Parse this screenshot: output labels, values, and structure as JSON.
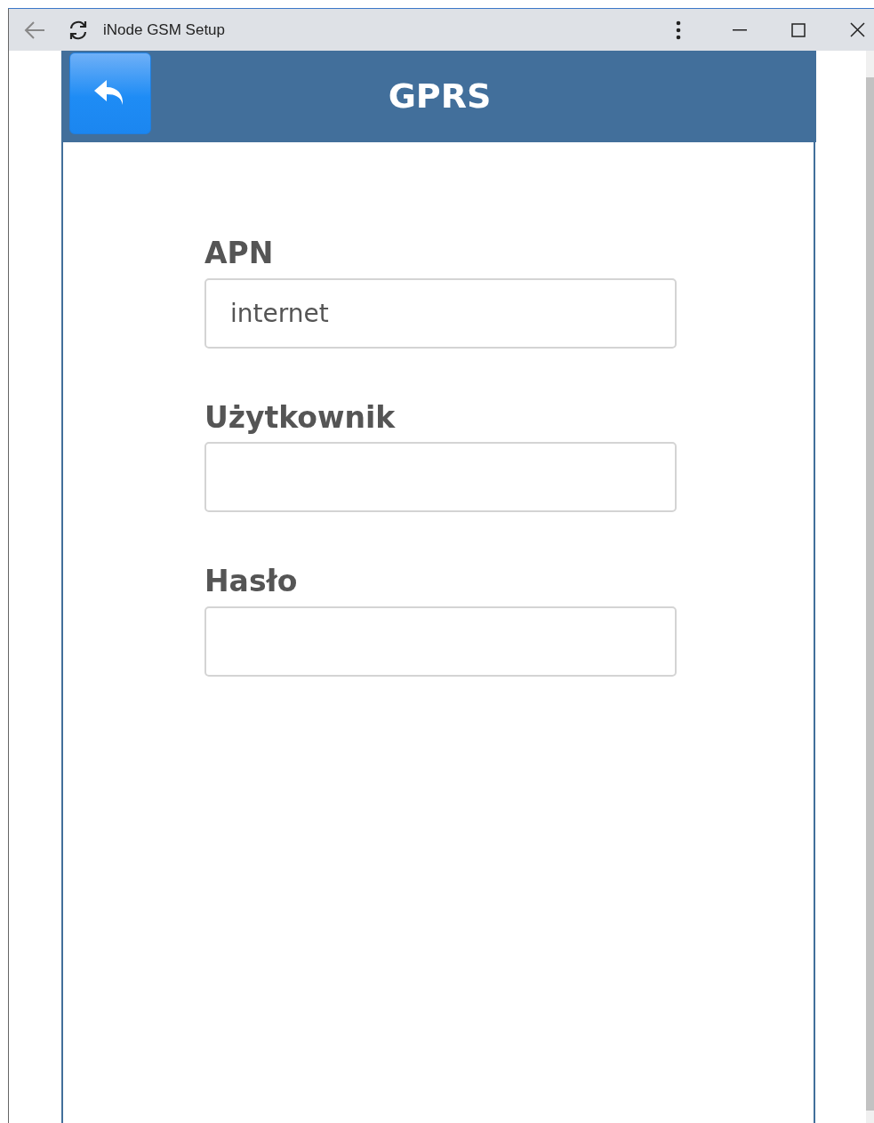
{
  "window": {
    "title": "iNode GSM Setup"
  },
  "header": {
    "title": "GPRS"
  },
  "fields": [
    {
      "label": "APN",
      "value": "internet"
    },
    {
      "label": "Użytkownik"
    },
    {
      "label": "Hasło"
    }
  ]
}
